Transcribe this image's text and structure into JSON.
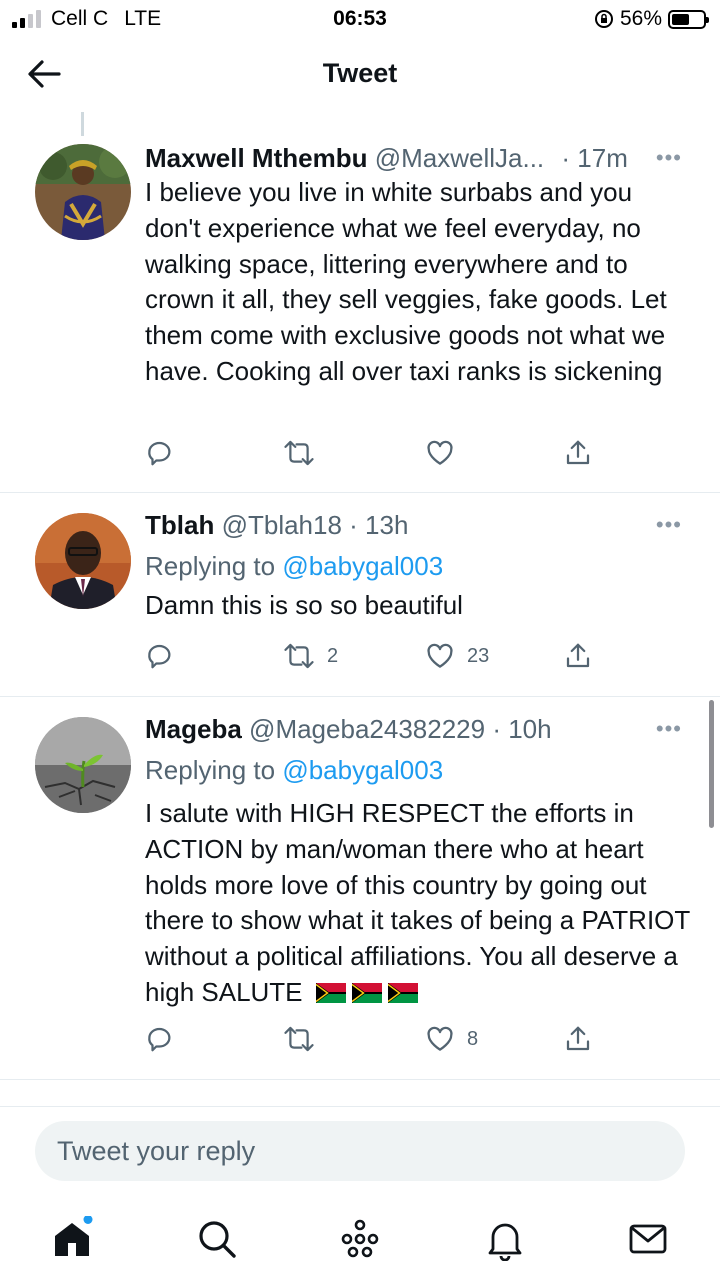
{
  "status_bar": {
    "carrier": "Cell C",
    "network": "LTE",
    "time": "06:53",
    "battery": "56%",
    "battery_level": 0.56
  },
  "header": {
    "title": "Tweet"
  },
  "tweets": [
    {
      "name": "Maxwell Mthembu",
      "handle": "@MaxwellJa...",
      "time": "· 17m",
      "text": "I believe you live in white surbabs and you don't experience what we feel everyday, no walking space, littering everywhere and to crown it all, they sell veggies, fake goods. Let them come with exclusive goods not what we have. Cooking all over taxi ranks is sickening",
      "retweets": "",
      "likes": ""
    },
    {
      "name": "Tblah",
      "handle": "@Tblah18",
      "time": "· 13h",
      "replying_prefix": "Replying to",
      "replying_to": "@babygal003",
      "text": "Damn this is so so beautiful",
      "retweets": "2",
      "likes": "23"
    },
    {
      "name": "Mageba",
      "handle": "@Mageba24382229",
      "time": "· 10h",
      "replying_prefix": "Replying to",
      "replying_to": "@babygal003",
      "text": "I salute with HIGH RESPECT the efforts in ACTION by man/woman there who at heart holds more love of this country by going out there to show what it takes of being a PATRIOT without a political affiliations. You all deserve a high SALUTE",
      "retweets": "",
      "likes": "8"
    }
  ],
  "reply_bar": {
    "placeholder": "Tweet your reply"
  },
  "nav": [
    "home-icon",
    "search-icon",
    "spaces-icon",
    "notifications-icon",
    "messages-icon"
  ],
  "colors": {
    "accent": "#1d9bf0",
    "text": "#0f1419",
    "muted": "#536471"
  }
}
